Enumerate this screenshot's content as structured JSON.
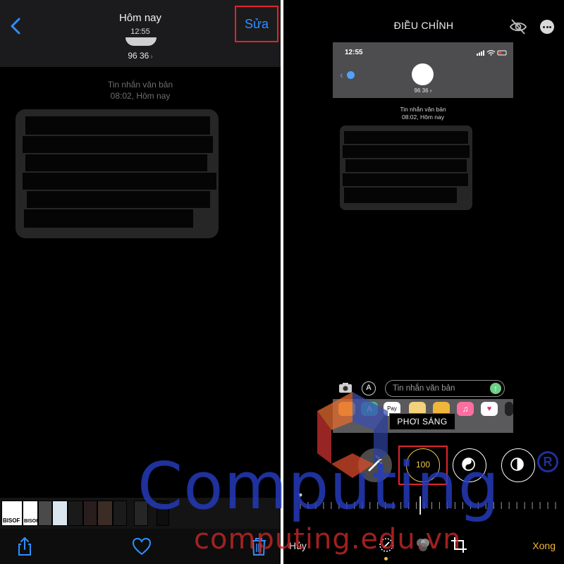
{
  "left": {
    "header": {
      "title": "Hôm nay",
      "time": "12:55",
      "edit_label": "Sửa"
    },
    "contact": {
      "number": "96 36",
      "chevron": "›"
    },
    "message_meta": {
      "type": "Tin nhắn văn bản",
      "timestamp": "08:02, Hôm nay"
    },
    "thumbnails": [
      {
        "label": "BISOF",
        "color": "#ffffff"
      },
      {
        "label": "BISOF",
        "color": "#ffffff"
      },
      {
        "label": "",
        "color": "#4a4a4a"
      },
      {
        "label": "",
        "color": "#d9e6f0"
      },
      {
        "label": "",
        "color": "#1a1a1a"
      },
      {
        "label": "",
        "color": "#2a1d1d"
      },
      {
        "label": "",
        "color": "#3b2c25"
      },
      {
        "label": "",
        "color": "#1b1b1b"
      },
      {
        "label": "",
        "color": "#262626"
      },
      {
        "label": "",
        "color": "#0e0e0e"
      }
    ],
    "toolbar": {
      "icons": [
        "share-icon",
        "heart-icon",
        "trash-icon"
      ]
    },
    "colors": {
      "accent": "#2f8fff",
      "highlight": "#e0242c"
    }
  },
  "right": {
    "header": {
      "title": "ĐIỀU CHỈNH"
    },
    "preview": {
      "status_time": "12:55",
      "contact": "96 36 ›",
      "message_type": "Tin nhắn văn bản",
      "message_time": "08:02, Hôm nay",
      "input_placeholder": "Tin nhắn văn bản",
      "apps": [
        {
          "name": "photos",
          "color": "#f5c542",
          "text": ""
        },
        {
          "name": "app-store",
          "color": "#3fbf9a",
          "text": "A"
        },
        {
          "name": "apple-pay",
          "color": "#ffffff",
          "text": "Pay"
        },
        {
          "name": "memoji",
          "color": "#f2d27a",
          "text": ""
        },
        {
          "name": "animoji",
          "color": "#f0b63a",
          "text": ""
        },
        {
          "name": "music",
          "color": "#ff6ea0",
          "text": "♫"
        },
        {
          "name": "digital-touch",
          "color": "#ffffff",
          "text": "♥"
        },
        {
          "name": "more",
          "color": "#222222",
          "text": ""
        }
      ]
    },
    "adjust": {
      "label": "PHƠI SÁNG",
      "value": "100",
      "slider_position": 0.47
    },
    "footer": {
      "cancel": "Hủy",
      "done": "Xong"
    },
    "colors": {
      "accent": "#f3b63a",
      "ring": "#f0c94a"
    }
  },
  "watermark": {
    "main": "Computing",
    "registered": "R",
    "sub": "computing.edu.vn"
  }
}
